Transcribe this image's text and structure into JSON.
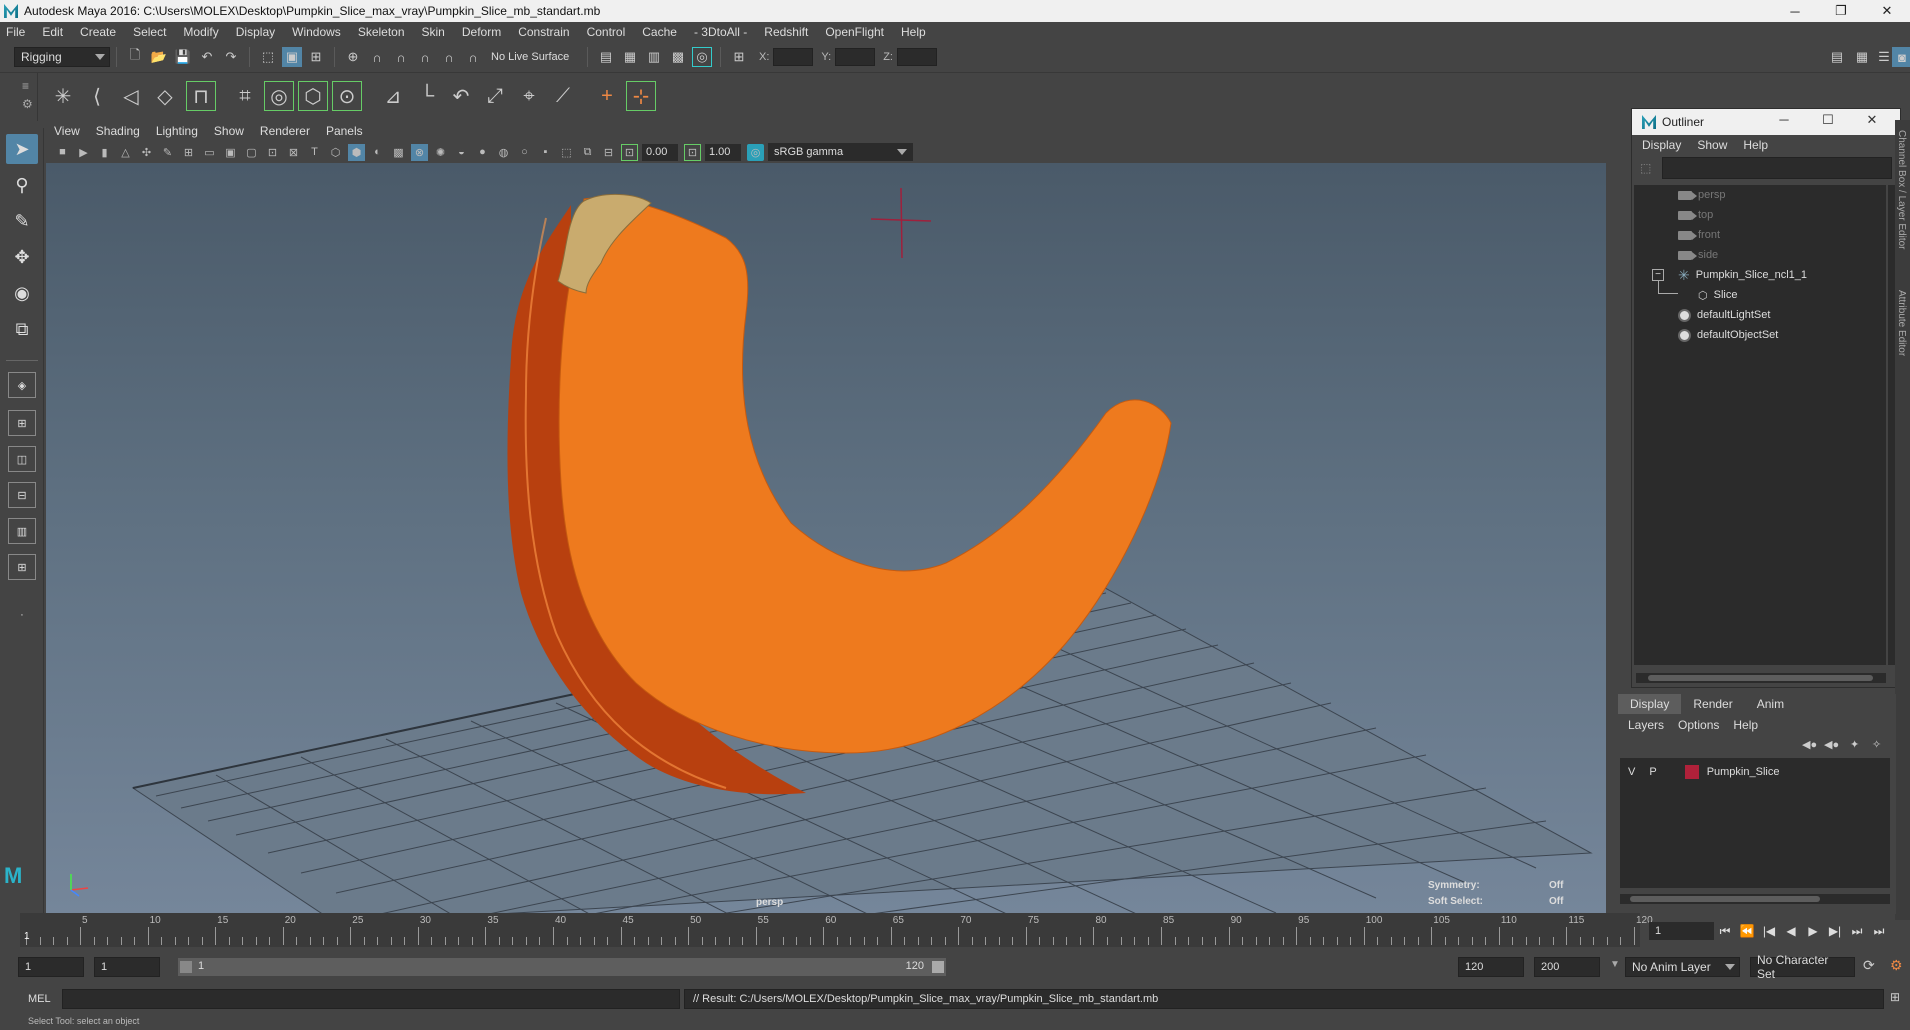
{
  "window": {
    "title": "Autodesk Maya 2016: C:\\Users\\MOLEX\\Desktop\\Pumpkin_Slice_max_vray\\Pumpkin_Slice_mb_standart.mb",
    "minimize": "─",
    "restore": "❐",
    "close": "✕"
  },
  "menubar": [
    "File",
    "Edit",
    "Create",
    "Select",
    "Modify",
    "Display",
    "Windows",
    "Skeleton",
    "Skin",
    "Deform",
    "Constrain",
    "Control",
    "Cache",
    "- 3DtoAll -",
    "Redshift",
    "OpenFlight",
    "Help"
  ],
  "statusline": {
    "menuset": "Rigging",
    "live_surface": "No Live Surface",
    "x_label": "X:",
    "y_label": "Y:",
    "z_label": "Z:"
  },
  "viewport": {
    "menus": [
      "View",
      "Shading",
      "Lighting",
      "Show",
      "Renderer",
      "Panels"
    ],
    "exposure": "0.00",
    "gamma": "1.00",
    "color_space": "sRGB gamma",
    "camera_label": "persp",
    "symmetry_label": "Symmetry:",
    "symmetry_value": "Off",
    "soft_select_label": "Soft Select:",
    "soft_select_value": "Off"
  },
  "outliner": {
    "title": "Outliner",
    "menus": [
      "Display",
      "Show",
      "Help"
    ],
    "items": [
      "persp",
      "top",
      "front",
      "side",
      "Pumpkin_Slice_ncl1_1",
      "Slice",
      "defaultLightSet",
      "defaultObjectSet"
    ]
  },
  "side_tabs": [
    "Channel Box / Layer Editor",
    "Attribute Editor"
  ],
  "layer_editor": {
    "tabs": [
      "Display",
      "Render",
      "Anim"
    ],
    "menus": [
      "Layers",
      "Options",
      "Help"
    ],
    "layer": {
      "visible": "V",
      "playback": "P",
      "name": "Pumpkin_Slice",
      "color": "#b0213a"
    }
  },
  "timeslider": {
    "start": 1,
    "end": 120,
    "ticks": [
      5,
      10,
      15,
      20,
      25,
      30,
      35,
      40,
      45,
      50,
      55,
      60,
      65,
      70,
      75,
      80,
      85,
      90,
      95,
      100,
      105,
      110,
      115,
      120
    ],
    "current_frame": "1"
  },
  "playback_controls": [
    "⏮",
    "⏪",
    "|◀",
    "◀",
    "▶",
    "▶|",
    "⏭",
    "⏭"
  ],
  "range": {
    "start": "1",
    "playback_start": "1",
    "slider_start": "1",
    "slider_end": "120",
    "playback_end": "120",
    "end": "200",
    "anim_layer": "No Anim Layer",
    "character_set": "No Character Set"
  },
  "commandline": {
    "language": "MEL",
    "result": "// Result: C:/Users/MOLEX/Desktop/Pumpkin_Slice_max_vray/Pumpkin_Slice_mb_standart.mb"
  },
  "helpline": "Select Tool: select an object"
}
